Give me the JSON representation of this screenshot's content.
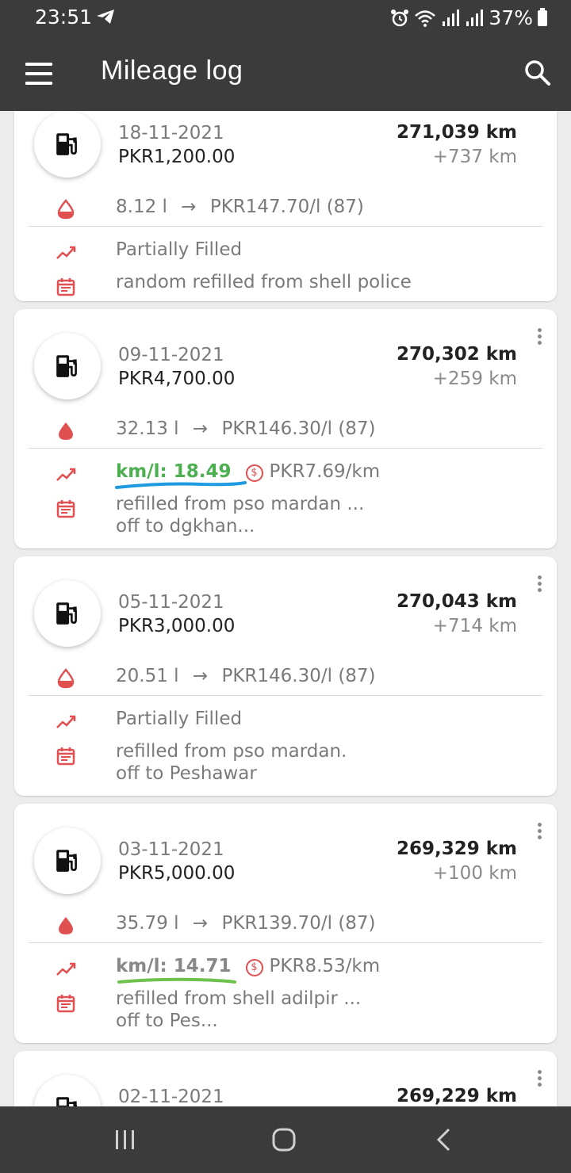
{
  "status": {
    "time": "23:51",
    "battery": "37%"
  },
  "appbar": {
    "title": "Mileage log",
    "menu_icon": "hamburger-icon",
    "search_icon": "search-icon"
  },
  "colors": {
    "accent": "#e05050",
    "good": "#4caf50",
    "bar": "#3b3b3b"
  },
  "entries": [
    {
      "date": "18-11-2021",
      "amount": "PKR1,200.00",
      "odometer": "271,039 km",
      "delta": "+737 km",
      "volume": "8.12 l",
      "arrow": "→",
      "price": "PKR147.70/l (87)",
      "fill": "partial",
      "stat": "Partially Filled",
      "note": "random refilled from shell police"
    },
    {
      "date": "09-11-2021",
      "amount": "PKR4,700.00",
      "odometer": "270,302 km",
      "delta": "+259 km",
      "volume": "32.13 l",
      "arrow": "→",
      "price": "PKR146.30/l (87)",
      "fill": "full",
      "kml": "km/l: 18.49",
      "cost_icon": "$",
      "cost": "PKR7.69/km",
      "note1": "refilled from pso mardan ...",
      "note2": "off to dgkhan..."
    },
    {
      "date": "05-11-2021",
      "amount": "PKR3,000.00",
      "odometer": "270,043 km",
      "delta": "+714 km",
      "volume": "20.51 l",
      "arrow": "→",
      "price": "PKR146.30/l (87)",
      "fill": "partial",
      "stat": "Partially Filled",
      "note1": "refilled from pso mardan.",
      "note2": "off to Peshawar"
    },
    {
      "date": "03-11-2021",
      "amount": "PKR5,000.00",
      "odometer": "269,329 km",
      "delta": "+100 km",
      "volume": "35.79 l",
      "arrow": "→",
      "price": "PKR139.70/l (87)",
      "fill": "full",
      "kml": "km/l: 14.71",
      "cost_icon": "$",
      "cost": "PKR8.53/km",
      "note1": "refilled from shell adilpir ...",
      "note2": "off to Pes..."
    },
    {
      "date": "02-11-2021",
      "odometer": "269,229 km"
    }
  ]
}
